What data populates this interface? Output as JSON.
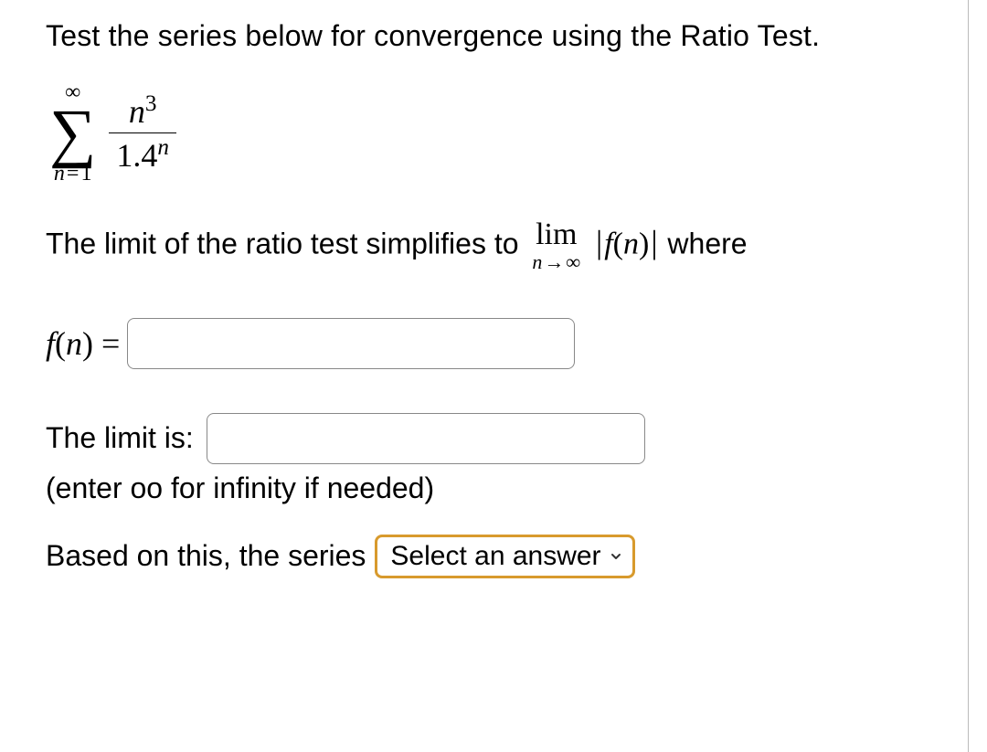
{
  "prompt": "Test the series below for convergence using the Ratio Test.",
  "series": {
    "upper": "∞",
    "lower_var": "n",
    "lower_eq": "=",
    "lower_val": "1",
    "num_base": "n",
    "num_exp": "3",
    "den_base": "1.4",
    "den_exp": "n"
  },
  "limit_sentence": {
    "pre": "The limit of the ratio test simplifies to ",
    "lim": "lim",
    "sub_var": "n",
    "sub_arrow": "→",
    "sub_inf": "∞",
    "fofn_f": "f",
    "fofn_open": "(",
    "fofn_var": "n",
    "fofn_close": ")",
    "post": " where"
  },
  "fn_label": {
    "f": "f",
    "open": "(",
    "var": "n",
    "close": ")",
    "eq": " ="
  },
  "inputs": {
    "fn_value": "",
    "limit_value": ""
  },
  "limit_is": "The limit is:",
  "hint": "(enter oo for infinity if needed)",
  "conclusion_pre": "Based on this, the series",
  "select": {
    "placeholder": "Select an answer"
  }
}
